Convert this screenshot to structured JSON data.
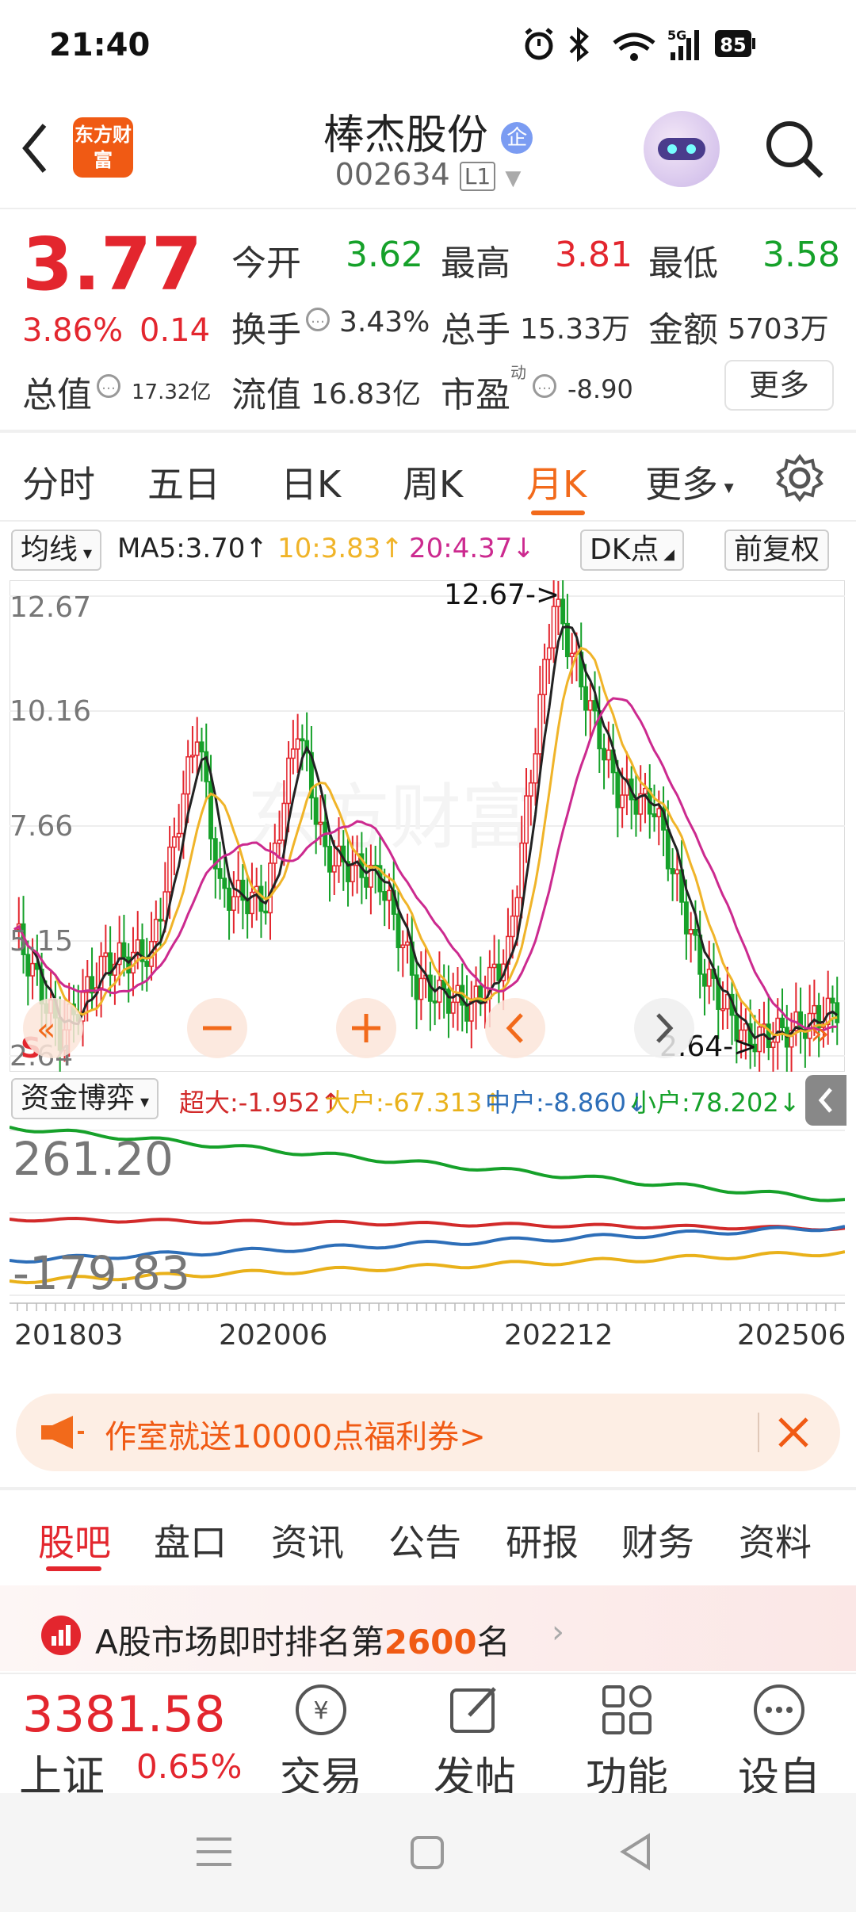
{
  "status_bar": {
    "time": "21:40",
    "signal": "5G",
    "battery": "85"
  },
  "header": {
    "brand_logo_text": "东方财富",
    "stock_name": "棒杰股份",
    "badge": "企",
    "stock_code": "002634",
    "level": "L1"
  },
  "quote": {
    "price": "3.77",
    "change_pct": "3.86%",
    "change_val": "0.14",
    "open_label": "今开",
    "open": "3.62",
    "high_label": "最高",
    "high": "3.81",
    "low_label": "最低",
    "low": "3.58",
    "turnover_label": "换手",
    "turnover": "3.43%",
    "volume_label": "总手",
    "volume": "15.33万",
    "amount_label": "金额",
    "amount": "5703万",
    "mktcap_label": "总值",
    "mktcap": "17.32亿",
    "float_label": "流值",
    "float": "16.83亿",
    "pe_label": "市盈",
    "pe_sup": "动",
    "pe": "-8.90",
    "more_button": "更多"
  },
  "chart_tabs": [
    "分时",
    "五日",
    "日K",
    "周K",
    "月K",
    "更多"
  ],
  "active_tab": "月K",
  "ma_row": {
    "selector": "均线",
    "ma5": "MA5:3.70↑",
    "ma10": "10:3.83↑",
    "ma20": "20:4.37↓",
    "dk": "DK点",
    "adjust": "前复权"
  },
  "kline": {
    "y_labels": [
      "12.67",
      "10.16",
      "7.66",
      "5.15",
      "2.64"
    ],
    "max_marker": "12.67->",
    "min_marker": "2.64->",
    "s_marker": "S",
    "watermark": "东方财富"
  },
  "fund_flow": {
    "selector": "资金博弈",
    "super": "超大:-1.952↑",
    "big": "大户:-67.313↑",
    "mid": "中户:-8.860↓",
    "small": "小户:78.202↓",
    "y_top": "261.20",
    "y_bottom": "-179.83"
  },
  "x_labels": [
    "201803",
    "202006",
    "202212",
    "202506"
  ],
  "colors": {
    "up": "#e3262e",
    "down": "#16a12a",
    "ma5": "#222222",
    "ma10": "#f0b429",
    "ma20": "#cc2a8f",
    "accent": "#f26a1b"
  },
  "banner": {
    "text": "作室就送10000点福利券>"
  },
  "bottom_tabs": [
    "股吧",
    "盘口",
    "资讯",
    "公告",
    "研报",
    "财务",
    "资料"
  ],
  "rank": {
    "prefix": "A股市场即时排名第",
    "rank": "2600",
    "suffix": "名"
  },
  "footer": {
    "index_value": "3381.58",
    "index_name": "上证",
    "index_change": "0.65%",
    "trade": "交易",
    "post": "发帖",
    "function": "功能",
    "watchlist": "设自"
  }
}
